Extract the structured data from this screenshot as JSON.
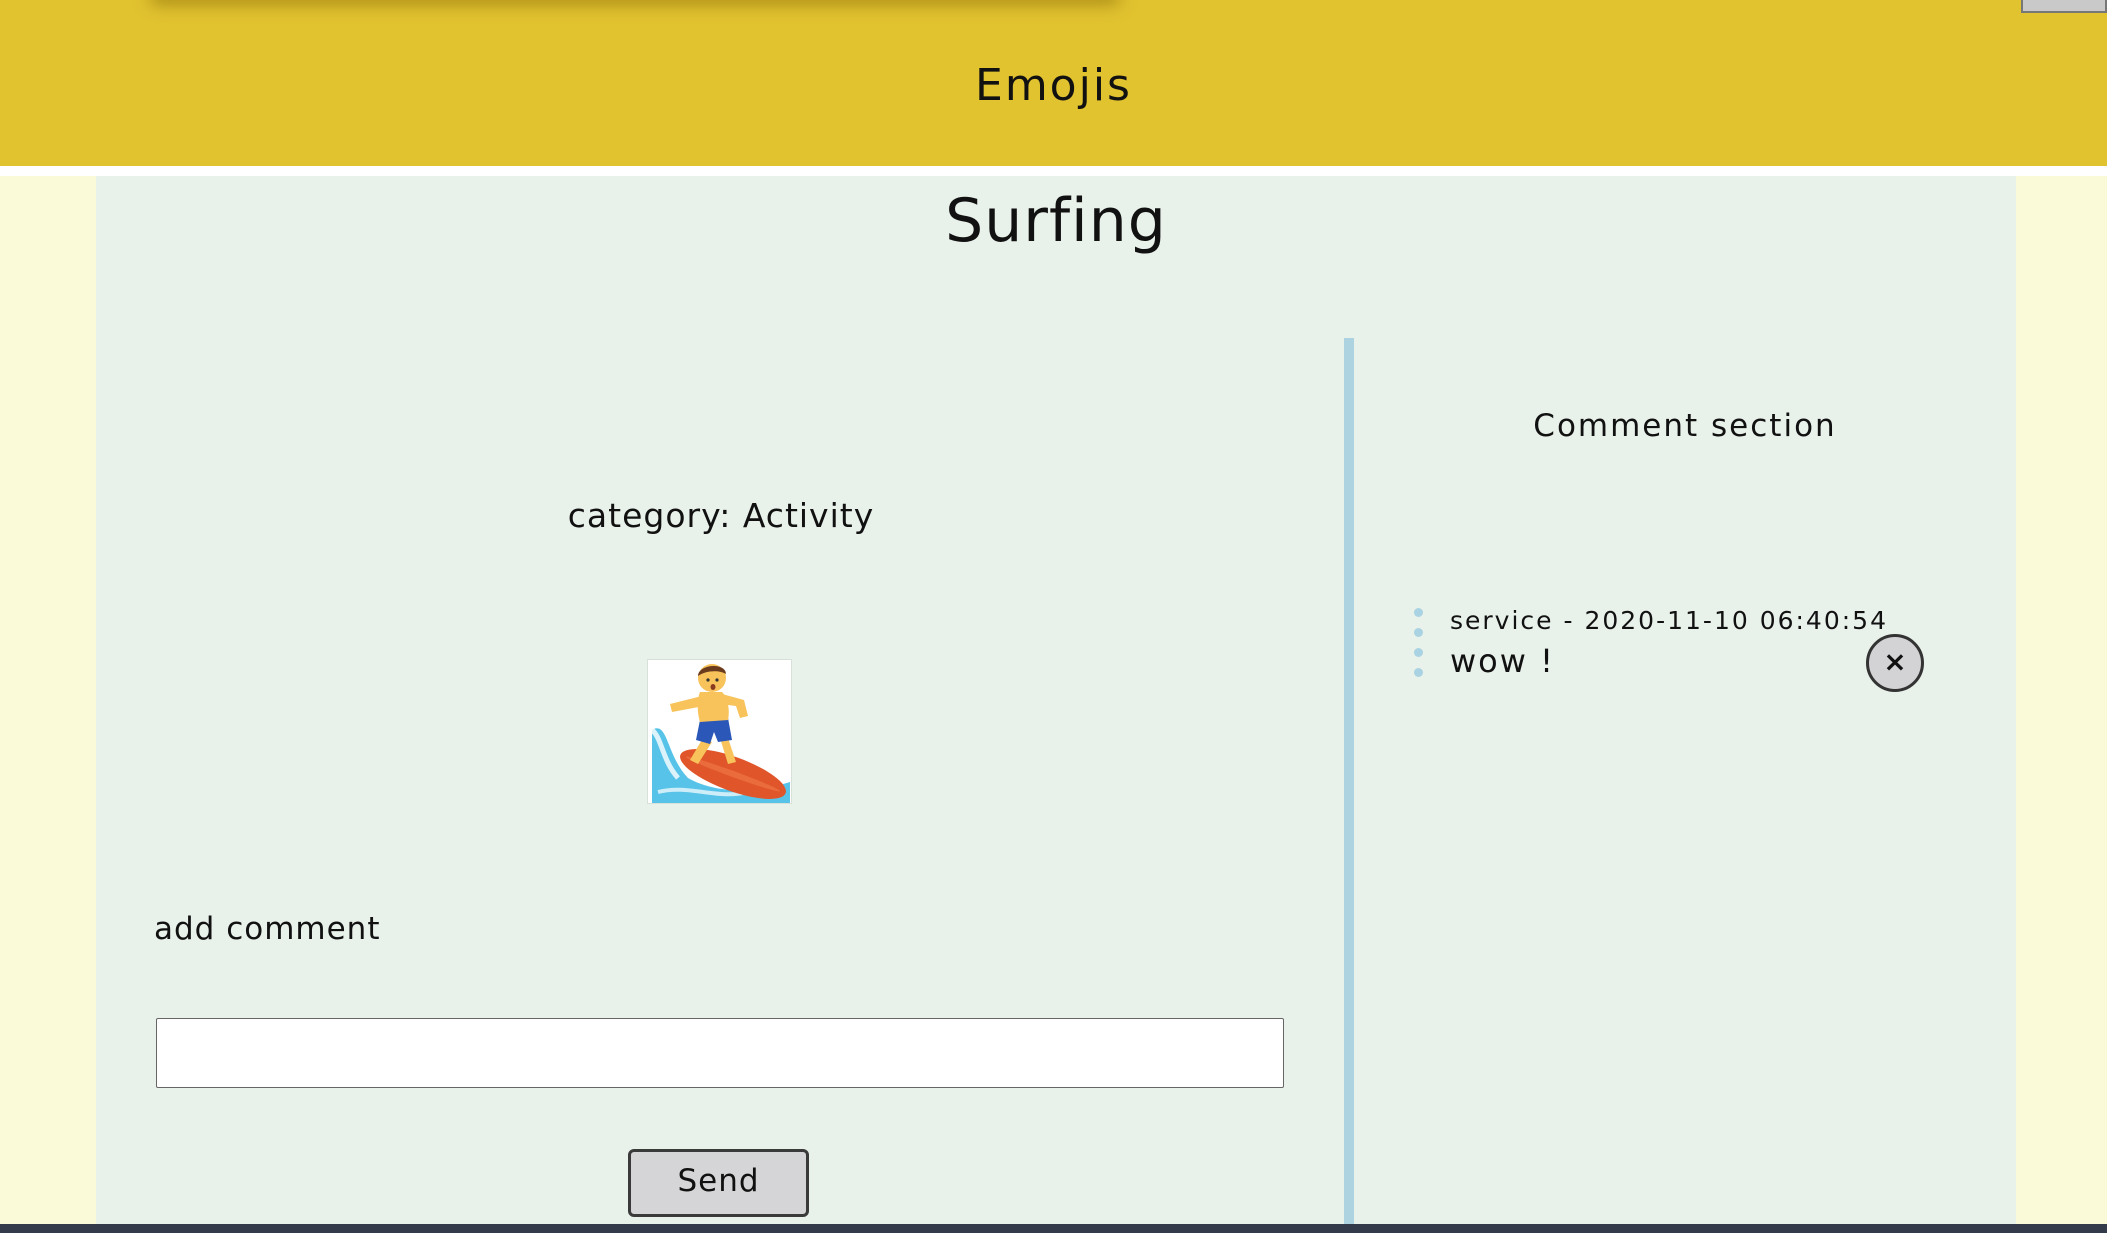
{
  "header": {
    "title": "Emojis"
  },
  "main": {
    "title": "Surfing",
    "category": "category: Activity",
    "emoji": {
      "name": "person-surfing-emoji",
      "description_icon": "surfer-icon"
    },
    "add_comment_label": "add comment",
    "comment_input": {
      "value": "",
      "placeholder": ""
    },
    "send_label": "Send"
  },
  "comments": {
    "heading": "Comment section",
    "items": [
      {
        "author": "service",
        "timestamp": "2020-11-10 06:40:54",
        "meta": "service - 2020-11-10 06:40:54",
        "text": "wow !",
        "delete_label": "×"
      }
    ]
  },
  "colors": {
    "header_bg": "#e1c22f",
    "content_bg": "#e8f1ea",
    "page_bg": "#faf9d8",
    "divider": "#add3e0",
    "button_bg": "#d5d5d7"
  }
}
